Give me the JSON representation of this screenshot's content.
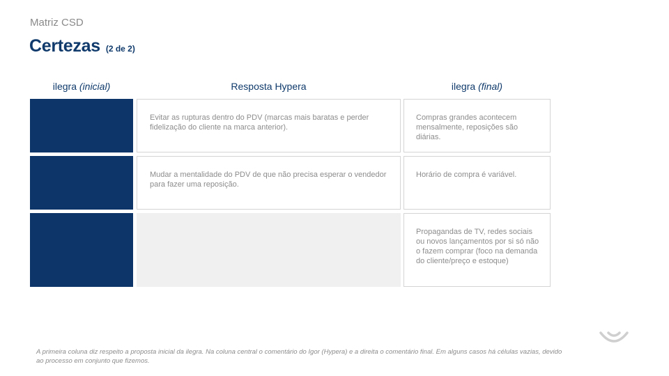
{
  "kicker": "Matriz CSD",
  "title": {
    "main": "Certezas",
    "sub": "(2 de 2)"
  },
  "columns": [
    {
      "label": "ilegra ",
      "label_em": "(inicial)"
    },
    {
      "label": "Resposta Hypera",
      "label_em": ""
    },
    {
      "label": "ilegra ",
      "label_em": "(final)"
    }
  ],
  "rows": [
    {
      "middle": "Evitar as rupturas dentro do PDV (marcas mais baratas e perder fidelização do cliente na marca anterior).",
      "final": "Compras grandes acontecem mensalmente, reposições são diárias."
    },
    {
      "middle": "Mudar a mentalidade do PDV de que não precisa esperar o vendedor para fazer uma reposição.",
      "final": "Horário de compra é variável."
    },
    {
      "middle": "",
      "final": "Propagandas de TV, redes sociais ou novos lançamentos por si só não o fazem comprar (foco na demanda do cliente/preço e estoque)"
    }
  ],
  "footnote": "A primeira coluna diz respeito a proposta inicial da ilegra. Na coluna central o comentário do Igor (Hypera) e a direita o comentário final. Em alguns casos há células vazias, devido ao processo em conjunto que fizemos.",
  "colors": {
    "navy": "#0d356a",
    "text_gray": "#8c8c8c",
    "empty_cell": "#f0f0f0"
  },
  "icons": {
    "logo": "smile-logo-icon"
  }
}
